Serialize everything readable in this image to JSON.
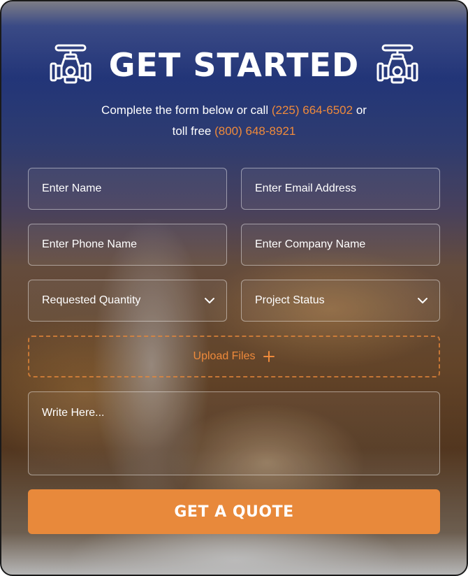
{
  "header": {
    "title": "GET STARTED",
    "left_icon": "valve-icon",
    "right_icon": "valve-icon"
  },
  "subtitle": {
    "line1_prefix": "Complete the form below or call ",
    "phone_local": "(225) 664-6502",
    "line1_suffix": " or",
    "line2_prefix": "toll free ",
    "phone_toll_free": "(800) 648-8921"
  },
  "form": {
    "name_placeholder": "Enter Name",
    "email_placeholder": "Enter Email Address",
    "phone_placeholder": "Enter Phone Name",
    "company_placeholder": "Enter Company Name",
    "quantity_select": "Requested Quantity",
    "status_select": "Project Status",
    "upload_label": "Upload Files",
    "message_placeholder": "Write Here...",
    "submit_label": "GET A QUOTE"
  },
  "colors": {
    "accent": "#e8893b",
    "phone_link": "#ef8a3b",
    "text": "#ffffff",
    "background_top": "#23367a",
    "background_bottom": "#6b4a2c"
  }
}
